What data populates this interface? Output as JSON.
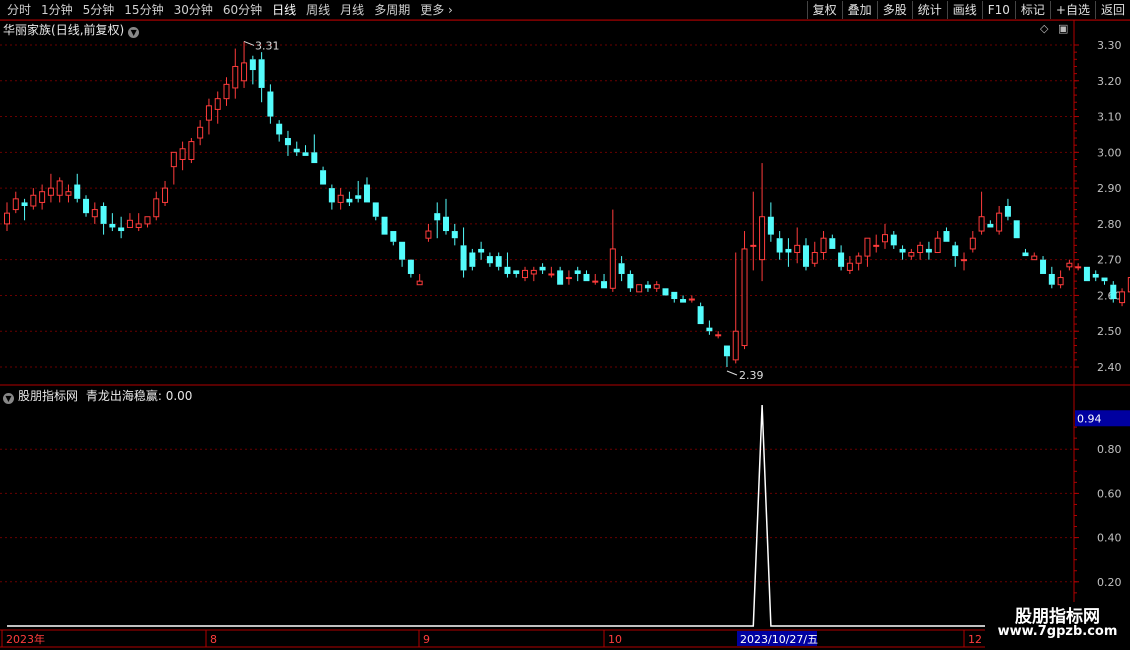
{
  "toolbar": {
    "periods": [
      "分时",
      "1分钟",
      "5分钟",
      "15分钟",
      "30分钟",
      "60分钟",
      "日线",
      "周线",
      "月线",
      "多周期",
      "更多"
    ],
    "active": "日线",
    "right_buttons": [
      "复权",
      "叠加",
      "多股",
      "统计",
      "画线",
      "F10",
      "标记",
      "+自选",
      "返回"
    ]
  },
  "main_chart": {
    "stock_name": "华丽家族",
    "mode": "(日线,前复权)",
    "high_label": "3.31",
    "low_label": "2.39",
    "y_ticks": [
      "3.30",
      "3.20",
      "3.10",
      "3.00",
      "2.90",
      "2.80",
      "2.70",
      "2.60",
      "2.50",
      "2.40"
    ]
  },
  "indicator": {
    "source": "股朋指标网",
    "name": "青龙出海稳赢:",
    "value": "0.00",
    "current_value": "0.94",
    "y_ticks": [
      "0.80",
      "0.60",
      "0.40",
      "0.20"
    ]
  },
  "time_axis": {
    "labels": [
      "2023年",
      "8",
      "9",
      "10",
      "12"
    ],
    "cursor_date": "2023/10/27/五"
  },
  "watermark": {
    "line1": "股朋指标网",
    "line2": "www.7gpzb.com"
  },
  "colors": {
    "up": "#ff3c3c",
    "down": "#54fcfc",
    "axis": "#b00000",
    "grid": "#6a0000",
    "cursor_bg": "#0000a0"
  },
  "chart_data": {
    "type": "candlestick",
    "ohlc": [
      [
        2.8,
        2.86,
        2.78,
        2.83
      ],
      [
        2.84,
        2.89,
        2.83,
        2.87
      ],
      [
        2.86,
        2.87,
        2.81,
        2.85
      ],
      [
        2.85,
        2.9,
        2.84,
        2.88
      ],
      [
        2.86,
        2.91,
        2.84,
        2.89
      ],
      [
        2.88,
        2.94,
        2.86,
        2.9
      ],
      [
        2.88,
        2.93,
        2.86,
        2.92
      ],
      [
        2.88,
        2.91,
        2.86,
        2.89
      ],
      [
        2.91,
        2.94,
        2.86,
        2.87
      ],
      [
        2.87,
        2.88,
        2.82,
        2.83
      ],
      [
        2.82,
        2.86,
        2.8,
        2.84
      ],
      [
        2.85,
        2.86,
        2.77,
        2.8
      ],
      [
        2.8,
        2.83,
        2.78,
        2.79
      ],
      [
        2.79,
        2.82,
        2.76,
        2.78
      ],
      [
        2.79,
        2.83,
        2.79,
        2.81
      ],
      [
        2.79,
        2.83,
        2.78,
        2.8
      ],
      [
        2.8,
        2.82,
        2.79,
        2.82
      ],
      [
        2.82,
        2.89,
        2.81,
        2.87
      ],
      [
        2.86,
        2.92,
        2.85,
        2.9
      ],
      [
        2.96,
        3.0,
        2.91,
        3.0
      ],
      [
        2.98,
        3.03,
        2.95,
        3.01
      ],
      [
        2.98,
        3.04,
        2.97,
        3.03
      ],
      [
        3.04,
        3.09,
        3.02,
        3.07
      ],
      [
        3.09,
        3.15,
        3.05,
        3.13
      ],
      [
        3.12,
        3.17,
        3.08,
        3.15
      ],
      [
        3.15,
        3.21,
        3.13,
        3.19
      ],
      [
        3.18,
        3.29,
        3.15,
        3.24
      ],
      [
        3.2,
        3.31,
        3.18,
        3.25
      ],
      [
        3.26,
        3.27,
        3.19,
        3.23
      ],
      [
        3.26,
        3.28,
        3.14,
        3.18
      ],
      [
        3.17,
        3.19,
        3.08,
        3.1
      ],
      [
        3.08,
        3.09,
        3.03,
        3.05
      ],
      [
        3.04,
        3.06,
        2.99,
        3.02
      ],
      [
        3.01,
        3.03,
        2.99,
        3.0
      ],
      [
        3.0,
        3.02,
        2.99,
        2.99
      ],
      [
        3.0,
        3.05,
        2.97,
        2.97
      ],
      [
        2.95,
        2.96,
        2.93,
        2.91
      ],
      [
        2.9,
        2.91,
        2.84,
        2.86
      ],
      [
        2.86,
        2.9,
        2.84,
        2.88
      ],
      [
        2.87,
        2.89,
        2.85,
        2.86
      ],
      [
        2.88,
        2.92,
        2.86,
        2.87
      ],
      [
        2.91,
        2.93,
        2.86,
        2.86
      ],
      [
        2.86,
        2.86,
        2.81,
        2.82
      ],
      [
        2.82,
        2.82,
        2.77,
        2.77
      ],
      [
        2.78,
        2.78,
        2.74,
        2.75
      ],
      [
        2.75,
        2.75,
        2.68,
        2.7
      ],
      [
        2.7,
        2.7,
        2.65,
        2.66
      ],
      [
        2.63,
        2.66,
        2.63,
        2.64
      ],
      [
        2.76,
        2.8,
        2.75,
        2.78
      ],
      [
        2.83,
        2.86,
        2.76,
        2.81
      ],
      [
        2.82,
        2.87,
        2.77,
        2.78
      ],
      [
        2.78,
        2.8,
        2.74,
        2.76
      ],
      [
        2.74,
        2.79,
        2.65,
        2.67
      ],
      [
        2.72,
        2.73,
        2.67,
        2.68
      ],
      [
        2.73,
        2.75,
        2.7,
        2.72
      ],
      [
        2.71,
        2.72,
        2.68,
        2.69
      ],
      [
        2.71,
        2.72,
        2.67,
        2.68
      ],
      [
        2.68,
        2.72,
        2.65,
        2.66
      ],
      [
        2.67,
        2.67,
        2.65,
        2.66
      ],
      [
        2.65,
        2.68,
        2.64,
        2.67
      ],
      [
        2.66,
        2.68,
        2.64,
        2.67
      ],
      [
        2.68,
        2.69,
        2.66,
        2.67
      ],
      [
        2.66,
        2.68,
        2.65,
        2.66
      ],
      [
        2.67,
        2.68,
        2.63,
        2.63
      ],
      [
        2.65,
        2.67,
        2.63,
        2.65
      ],
      [
        2.67,
        2.68,
        2.64,
        2.66
      ],
      [
        2.66,
        2.67,
        2.64,
        2.64
      ],
      [
        2.64,
        2.66,
        2.63,
        2.64
      ],
      [
        2.64,
        2.66,
        2.62,
        2.62
      ],
      [
        2.62,
        2.84,
        2.61,
        2.73
      ],
      [
        2.69,
        2.71,
        2.64,
        2.66
      ],
      [
        2.66,
        2.67,
        2.61,
        2.62
      ],
      [
        2.61,
        2.62,
        2.62,
        2.63
      ],
      [
        2.63,
        2.64,
        2.61,
        2.62
      ],
      [
        2.62,
        2.64,
        2.61,
        2.63
      ],
      [
        2.62,
        2.62,
        2.6,
        2.6
      ],
      [
        2.61,
        2.61,
        2.58,
        2.59
      ],
      [
        2.59,
        2.6,
        2.58,
        2.58
      ],
      [
        2.59,
        2.6,
        2.58,
        2.59
      ],
      [
        2.57,
        2.58,
        2.52,
        2.52
      ],
      [
        2.51,
        2.53,
        2.49,
        2.5
      ],
      [
        2.49,
        2.5,
        2.48,
        2.49
      ],
      [
        2.46,
        2.46,
        2.4,
        2.43
      ],
      [
        2.42,
        2.72,
        2.41,
        2.5
      ],
      [
        2.46,
        2.78,
        2.45,
        2.73
      ],
      [
        2.74,
        2.89,
        2.67,
        2.74
      ],
      [
        2.7,
        2.97,
        2.64,
        2.82
      ],
      [
        2.82,
        2.86,
        2.75,
        2.77
      ],
      [
        2.76,
        2.78,
        2.7,
        2.72
      ],
      [
        2.73,
        2.76,
        2.68,
        2.72
      ],
      [
        2.72,
        2.79,
        2.69,
        2.74
      ],
      [
        2.74,
        2.76,
        2.67,
        2.68
      ],
      [
        2.69,
        2.75,
        2.68,
        2.72
      ],
      [
        2.72,
        2.78,
        2.7,
        2.76
      ],
      [
        2.76,
        2.77,
        2.73,
        2.73
      ],
      [
        2.72,
        2.74,
        2.67,
        2.68
      ],
      [
        2.67,
        2.71,
        2.66,
        2.69
      ],
      [
        2.69,
        2.72,
        2.67,
        2.71
      ],
      [
        2.71,
        2.76,
        2.68,
        2.76
      ],
      [
        2.74,
        2.77,
        2.72,
        2.74
      ],
      [
        2.75,
        2.8,
        2.73,
        2.77
      ],
      [
        2.77,
        2.78,
        2.73,
        2.74
      ],
      [
        2.73,
        2.74,
        2.7,
        2.72
      ],
      [
        2.71,
        2.73,
        2.7,
        2.72
      ],
      [
        2.72,
        2.75,
        2.7,
        2.74
      ],
      [
        2.73,
        2.75,
        2.7,
        2.72
      ],
      [
        2.72,
        2.78,
        2.72,
        2.76
      ],
      [
        2.78,
        2.79,
        2.75,
        2.75
      ],
      [
        2.74,
        2.75,
        2.68,
        2.71
      ],
      [
        2.7,
        2.72,
        2.67,
        2.7
      ],
      [
        2.73,
        2.78,
        2.72,
        2.76
      ],
      [
        2.78,
        2.89,
        2.77,
        2.82
      ],
      [
        2.8,
        2.81,
        2.79,
        2.79
      ],
      [
        2.78,
        2.85,
        2.77,
        2.83
      ],
      [
        2.85,
        2.87,
        2.81,
        2.82
      ],
      [
        2.81,
        2.81,
        2.76,
        2.76
      ],
      [
        2.72,
        2.73,
        2.71,
        2.71
      ],
      [
        2.7,
        2.72,
        2.7,
        2.71
      ],
      [
        2.7,
        2.71,
        2.66,
        2.66
      ],
      [
        2.66,
        2.68,
        2.62,
        2.63
      ],
      [
        2.63,
        2.67,
        2.62,
        2.65
      ],
      [
        2.68,
        2.7,
        2.67,
        2.69
      ],
      [
        2.68,
        2.69,
        2.67,
        2.68
      ],
      [
        2.68,
        2.68,
        2.64,
        2.64
      ],
      [
        2.66,
        2.67,
        2.64,
        2.65
      ],
      [
        2.65,
        2.65,
        2.63,
        2.64
      ],
      [
        2.63,
        2.64,
        2.58,
        2.59
      ],
      [
        2.58,
        2.62,
        2.57,
        2.61
      ],
      [
        2.61,
        2.66,
        2.6,
        2.65
      ],
      [
        2.66,
        2.67,
        2.62,
        2.62
      ],
      [
        2.63,
        2.66,
        2.6,
        2.61
      ],
      [
        2.62,
        2.66,
        2.6,
        2.61
      ],
      [
        2.61,
        2.64,
        2.6,
        2.62
      ],
      [
        2.62,
        2.65,
        2.56,
        2.58
      ]
    ],
    "indicator_values": [
      0,
      0,
      0,
      0,
      0,
      0,
      0,
      0,
      0,
      0,
      0,
      0,
      0,
      0,
      0,
      0,
      0,
      0,
      0,
      0,
      0,
      0,
      0,
      0,
      0,
      0,
      0,
      0,
      0,
      0,
      0,
      0,
      0,
      0,
      0,
      0,
      0,
      0,
      0,
      0,
      0,
      0,
      0,
      0,
      0,
      0,
      0,
      0,
      0,
      0,
      0,
      0,
      0,
      0,
      0,
      0,
      0,
      0,
      0,
      0,
      0,
      0,
      0,
      0,
      0,
      0,
      0,
      0,
      0,
      0,
      0,
      0,
      0,
      0,
      0,
      0,
      0,
      0,
      0,
      0,
      0,
      0,
      0,
      0,
      0,
      0,
      1.0,
      0,
      0,
      0,
      0,
      0,
      0,
      0,
      0,
      0,
      0,
      0,
      0,
      0,
      0,
      0,
      0,
      0,
      0,
      0,
      0,
      0,
      0,
      0,
      0,
      0,
      0,
      0,
      0,
      0,
      0,
      0,
      0,
      0,
      0,
      0,
      0,
      0,
      0,
      0,
      0,
      0,
      0,
      0,
      0,
      0,
      0,
      0,
      0,
      0,
      0
    ],
    "price_range": [
      2.35,
      3.35
    ],
    "indicator_range": [
      0,
      1.0
    ],
    "spike_index": 87
  }
}
